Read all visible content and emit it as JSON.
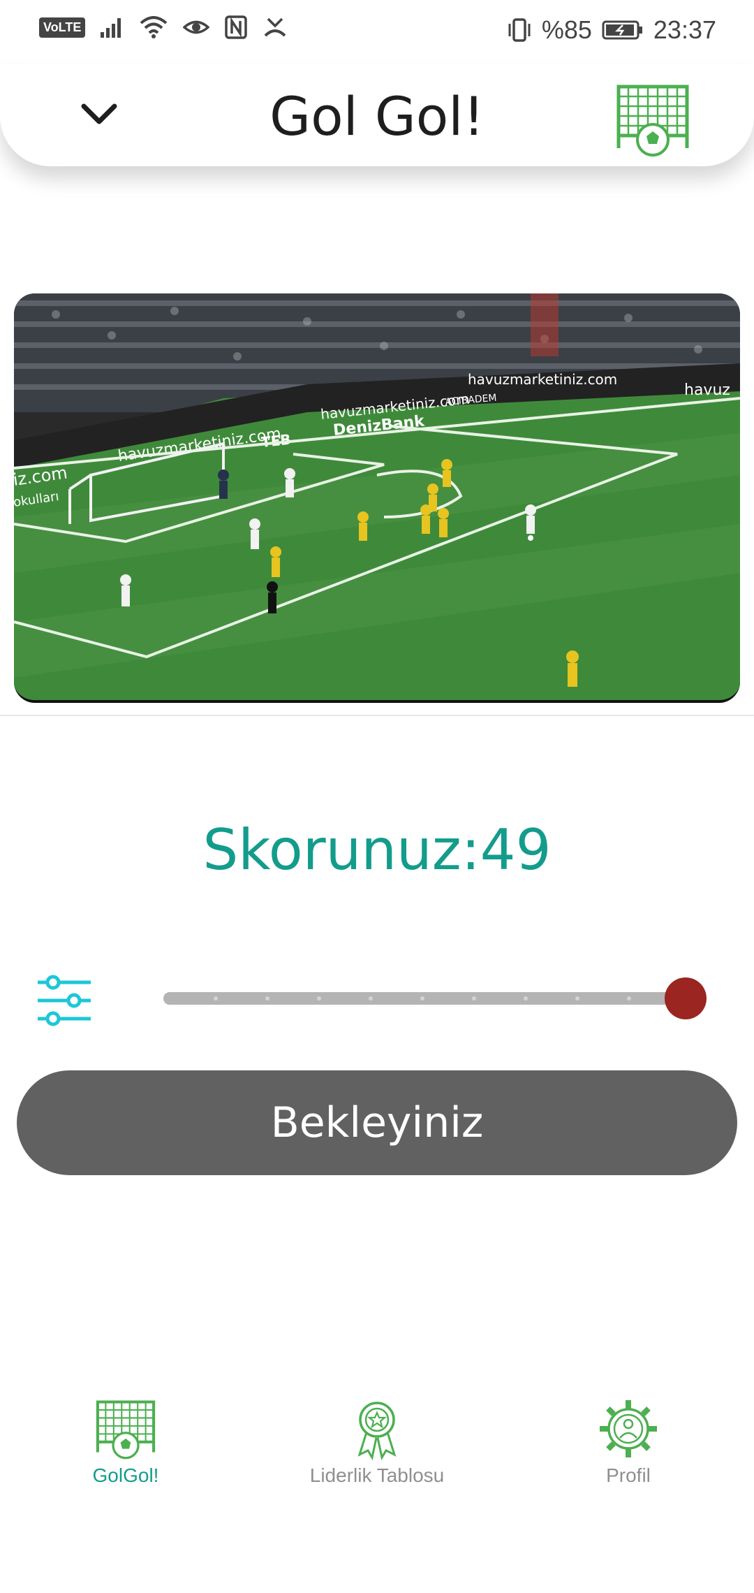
{
  "status_bar": {
    "network_badge": "VoLTE",
    "battery_percent": "%85",
    "time": "23:37",
    "icons": [
      "signal-icon",
      "wifi-icon",
      "eye-icon",
      "nfc-icon",
      "missed-call-icon",
      "vibrate-icon",
      "battery-icon"
    ]
  },
  "header": {
    "title": "Gol Gol!",
    "left_icon": "chevron-down-icon",
    "right_icon": "goal-net-ball-icon"
  },
  "video": {
    "banners": [
      "havuzmarketiniz.com",
      "havuzmarketiniz.com",
      "DenizBank",
      "TEB",
      "havuzmarketiniz.com",
      "havuz",
      "ACIBADEM",
      "iz.com",
      "okulları"
    ]
  },
  "score": {
    "text": "Skorunuz:49"
  },
  "slider": {
    "icon": "sliders-icon",
    "value_fraction": 1.0
  },
  "wait_button": {
    "label": "Bekleyiniz"
  },
  "bottom_nav": {
    "items": [
      {
        "label": "GolGol!",
        "icon": "goal-net-ball-icon",
        "active": true
      },
      {
        "label": "Liderlik Tablosu",
        "icon": "award-ribbon-icon",
        "active": false
      },
      {
        "label": "Profil",
        "icon": "gear-user-icon",
        "active": false
      }
    ]
  },
  "colors": {
    "accent": "#139c8c",
    "goal_icon_green": "#4caf50",
    "knob": "#9b2520",
    "button_bg": "#616161",
    "filter_icon": "#1ec6d8"
  }
}
